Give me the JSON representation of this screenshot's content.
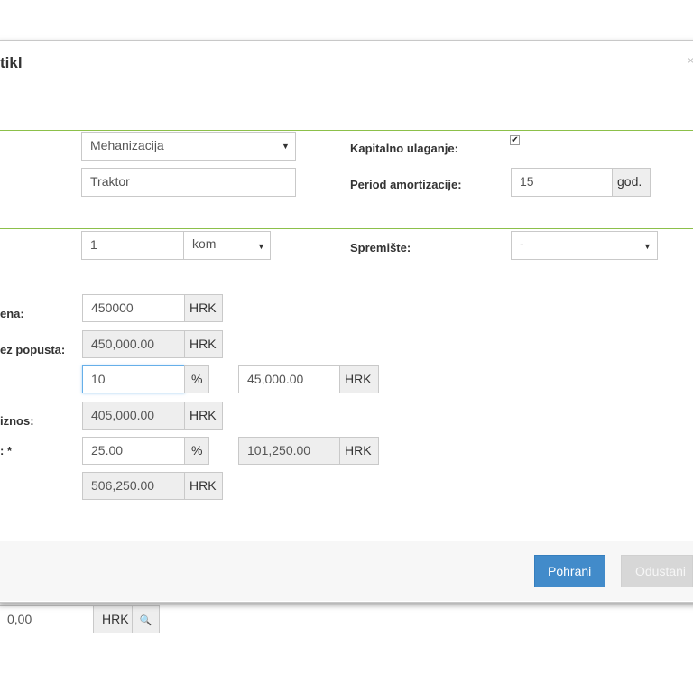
{
  "modal": {
    "title": "tikl",
    "close": "×"
  },
  "section1": {
    "category_select": "Mehanizacija",
    "name_input": "Traktor",
    "capital_label": "Kapitalno ulaganje:",
    "capital_checked": true,
    "capital_check_mark": "✔",
    "amort_label": "Period amortizacije:",
    "amort_value": "15",
    "amort_unit": "god."
  },
  "section2": {
    "quantity_value": "1",
    "unit_select": "kom",
    "storage_label": "Spremište:",
    "storage_select": "-"
  },
  "section3": {
    "price_label": "ena:",
    "price_value": "450000",
    "price_currency": "HRK",
    "no_discount_label": "ez popusta:",
    "no_discount_value": "450,000.00",
    "no_discount_currency": "HRK",
    "discount_percent": "10",
    "discount_percent_unit": "%",
    "discount_amount": "45,000.00",
    "discount_currency": "HRK",
    "base_label": "iznos:",
    "base_value": "405,000.00",
    "base_currency": "HRK",
    "tax_label": ": *",
    "tax_percent": "25.00",
    "tax_percent_unit": "%",
    "tax_amount": "101,250.00",
    "tax_currency": "HRK",
    "total_value": "506,250.00",
    "total_currency": "HRK"
  },
  "footer": {
    "save_label": "Pohrani",
    "cancel_label": "Odustani"
  },
  "background": {
    "amount_value": "0,00",
    "amount_currency": "HRK",
    "search_icon_name": "magnifier-icon",
    "search_glyph": "🔍"
  },
  "colors": {
    "accent_green": "#8cc04a",
    "primary_button": "#428bca"
  }
}
